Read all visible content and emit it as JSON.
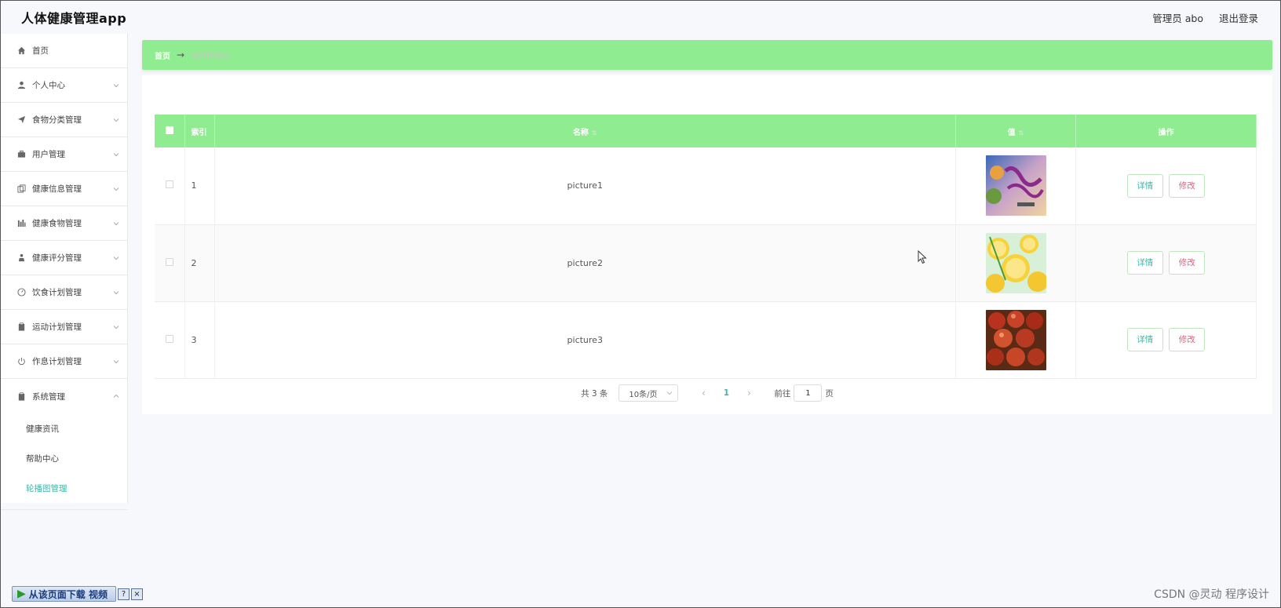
{
  "header": {
    "app_title": "人体健康管理app",
    "admin_label": "管理员 abo",
    "logout_label": "退出登录"
  },
  "sidebar": {
    "items": [
      {
        "label": "首页",
        "icon": "home-icon",
        "has_chevron": false
      },
      {
        "label": "个人中心",
        "icon": "user-icon",
        "has_chevron": true
      },
      {
        "label": "食物分类管理",
        "icon": "send-icon",
        "has_chevron": true
      },
      {
        "label": "用户管理",
        "icon": "briefcase-icon",
        "has_chevron": true
      },
      {
        "label": "健康信息管理",
        "icon": "copy-icon",
        "has_chevron": true
      },
      {
        "label": "健康食物管理",
        "icon": "bar-chart-icon",
        "has_chevron": true
      },
      {
        "label": "健康评分管理",
        "icon": "person-icon",
        "has_chevron": true
      },
      {
        "label": "饮食计划管理",
        "icon": "dashboard-icon",
        "has_chevron": true
      },
      {
        "label": "运动计划管理",
        "icon": "clipboard-icon",
        "has_chevron": true
      },
      {
        "label": "作息计划管理",
        "icon": "power-icon",
        "has_chevron": true
      },
      {
        "label": "系统管理",
        "icon": "clipboard-icon",
        "has_chevron": true
      }
    ],
    "sub_items": [
      "健康资讯",
      "帮助中心",
      "轮播图管理"
    ]
  },
  "breadcrumb": {
    "home": "首页",
    "arrow": "→",
    "current": "轮播图管理"
  },
  "table": {
    "headers": {
      "index": "索引",
      "name": "名称",
      "value": "值",
      "actions": "操作"
    },
    "rows": [
      {
        "index": "1",
        "name": "picture1",
        "image": "poster-image"
      },
      {
        "index": "2",
        "name": "picture2",
        "image": "lemon-image"
      },
      {
        "index": "3",
        "name": "picture3",
        "image": "fruit-image"
      }
    ],
    "detail_label": "详情",
    "edit_label": "修改"
  },
  "pager": {
    "total": "共 3 条",
    "page_size": "10条/页",
    "current_page": "1",
    "goto_label": "前往",
    "goto_value": "1",
    "page_unit": "页"
  },
  "download_bar": {
    "label": "从该页面下载 视频",
    "help": "?",
    "close": "×"
  },
  "watermark": "CSDN @灵动 程序设计",
  "colors": {
    "accent_green": "#90ec90",
    "detail_text": "#3cb8a8",
    "edit_text": "#e0607e"
  }
}
